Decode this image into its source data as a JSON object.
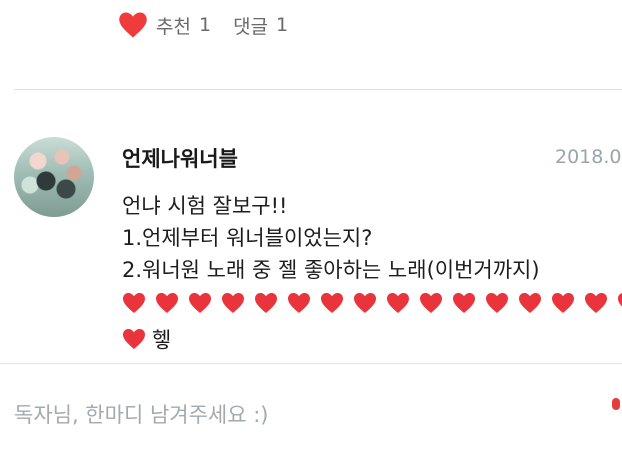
{
  "reactions": {
    "like_label": "추천",
    "like_count": "1",
    "comment_label": "댓글",
    "comment_count": "1",
    "heart_color": "#ef3b3b"
  },
  "comment": {
    "author": "언제나워너블",
    "date": "2018.0",
    "lines": [
      "언냐 시험 잘보구!!",
      "1.언제부터 워너블이었는지?",
      "2.워너원 노래 중 젤 좋아하는 노래(이번거까지)"
    ],
    "heart_row_count": 16,
    "last_line_text": "헿"
  },
  "input": {
    "placeholder": "독자님, 한마디 남겨주세요 :)"
  }
}
